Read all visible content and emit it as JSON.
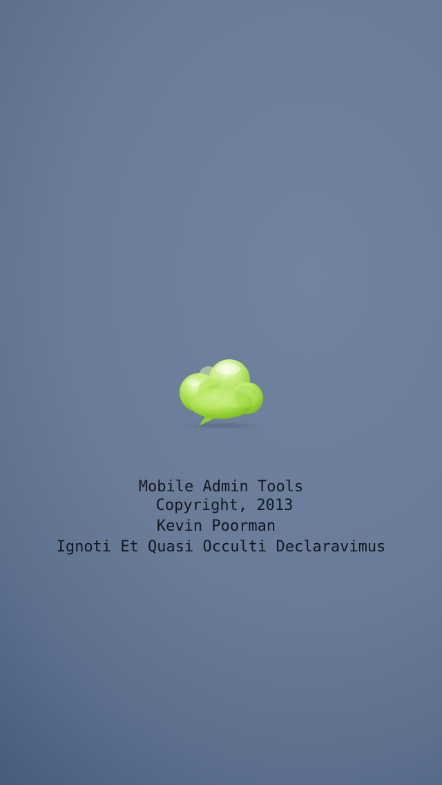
{
  "splash": {
    "logo_icon": "green-cloud-speech-bubble-icon",
    "app_name": "Mobile Admin Tools",
    "copyright": "Copyright, 2013",
    "author": "Kevin Poorman",
    "motto": "Ignoti Et Quasi Occulti Declaravimus"
  },
  "colors": {
    "background_light": "#7283a0",
    "background_dark": "#425677",
    "logo_green": "#9ed93a",
    "text": "#111722"
  }
}
